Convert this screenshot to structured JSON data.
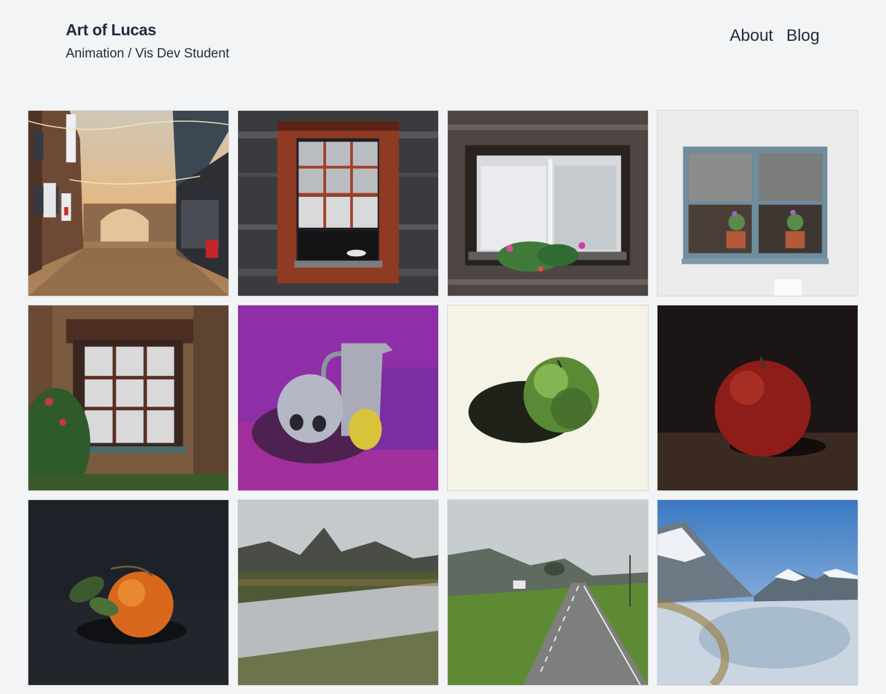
{
  "site": {
    "title": "Art of Lucas",
    "subtitle": "Animation / Vis Dev Student"
  },
  "nav": {
    "items": [
      {
        "label": "About"
      },
      {
        "label": "Blog"
      }
    ]
  },
  "gallery": {
    "artworks": [
      {
        "subject": "street-alley-with-string-lights",
        "sign_text": "AAMULEHTI",
        "store_sign": "AJ"
      },
      {
        "subject": "red-sash-window-on-dark-wood-wall"
      },
      {
        "subject": "white-window-with-flower-box"
      },
      {
        "subject": "blue-window-with-potted-plants"
      },
      {
        "subject": "rustic-window-with-red-bush"
      },
      {
        "subject": "skull-jug-lemon-still-life-purple"
      },
      {
        "subject": "green-apple-still-life"
      },
      {
        "subject": "red-apple-still-life"
      },
      {
        "subject": "tangerine-still-life"
      },
      {
        "subject": "river-landscape-with-mountains"
      },
      {
        "subject": "rural-road-landscape"
      },
      {
        "subject": "snowy-mountain-lake-landscape"
      }
    ]
  },
  "colors": {
    "background": "#f3f4f5",
    "text": "#1f2a3c"
  }
}
